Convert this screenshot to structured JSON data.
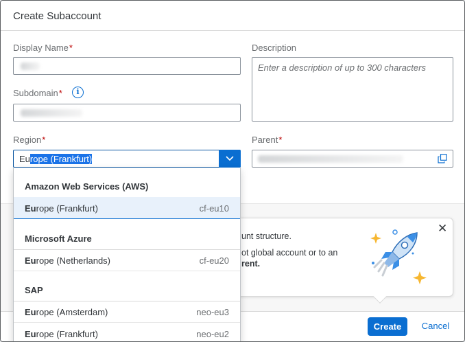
{
  "dialog": {
    "title": "Create Subaccount"
  },
  "form": {
    "display_name_label": "Display Name",
    "required_mark": "*",
    "subdomain_label": "Subdomain",
    "region_label": "Region",
    "description_label": "Description",
    "description_placeholder": "Enter a description of up to 300 characters",
    "parent_label": "Parent",
    "info_glyph": "i",
    "region_value_typed": "Eu",
    "region_value_selected": "rope (Frankfurt)"
  },
  "region_dropdown": {
    "groups": [
      {
        "label": "Amazon Web Services (AWS)",
        "options": [
          {
            "match": "Eu",
            "rest": "rope (Frankfurt)",
            "code": "cf-eu10",
            "selected": true
          }
        ]
      },
      {
        "label": "Microsoft Azure",
        "options": [
          {
            "match": "Eu",
            "rest": "rope (Netherlands)",
            "code": "cf-eu20",
            "selected": false
          }
        ]
      },
      {
        "label": "SAP",
        "options": [
          {
            "match": "Eu",
            "rest": "rope (Amsterdam)",
            "code": "neo-eu3",
            "selected": false
          },
          {
            "match": "Eu",
            "rest": "rope (Frankfurt)",
            "code": "neo-eu2",
            "selected": false
          }
        ]
      }
    ]
  },
  "tip": {
    "line1": "unt structure.",
    "line2": "ot global account or to an",
    "line3": "rent."
  },
  "footer": {
    "create_label": "Create",
    "cancel_label": "Cancel"
  },
  "colors": {
    "accent": "#0a6ed1",
    "required": "#bb0000",
    "selection": "#1a73e8"
  },
  "icons": {
    "info": "info-icon",
    "dropdown": "chevron-down-icon",
    "value_help": "copy-icon",
    "close": "close-icon",
    "illustration": "rocket-icon"
  }
}
